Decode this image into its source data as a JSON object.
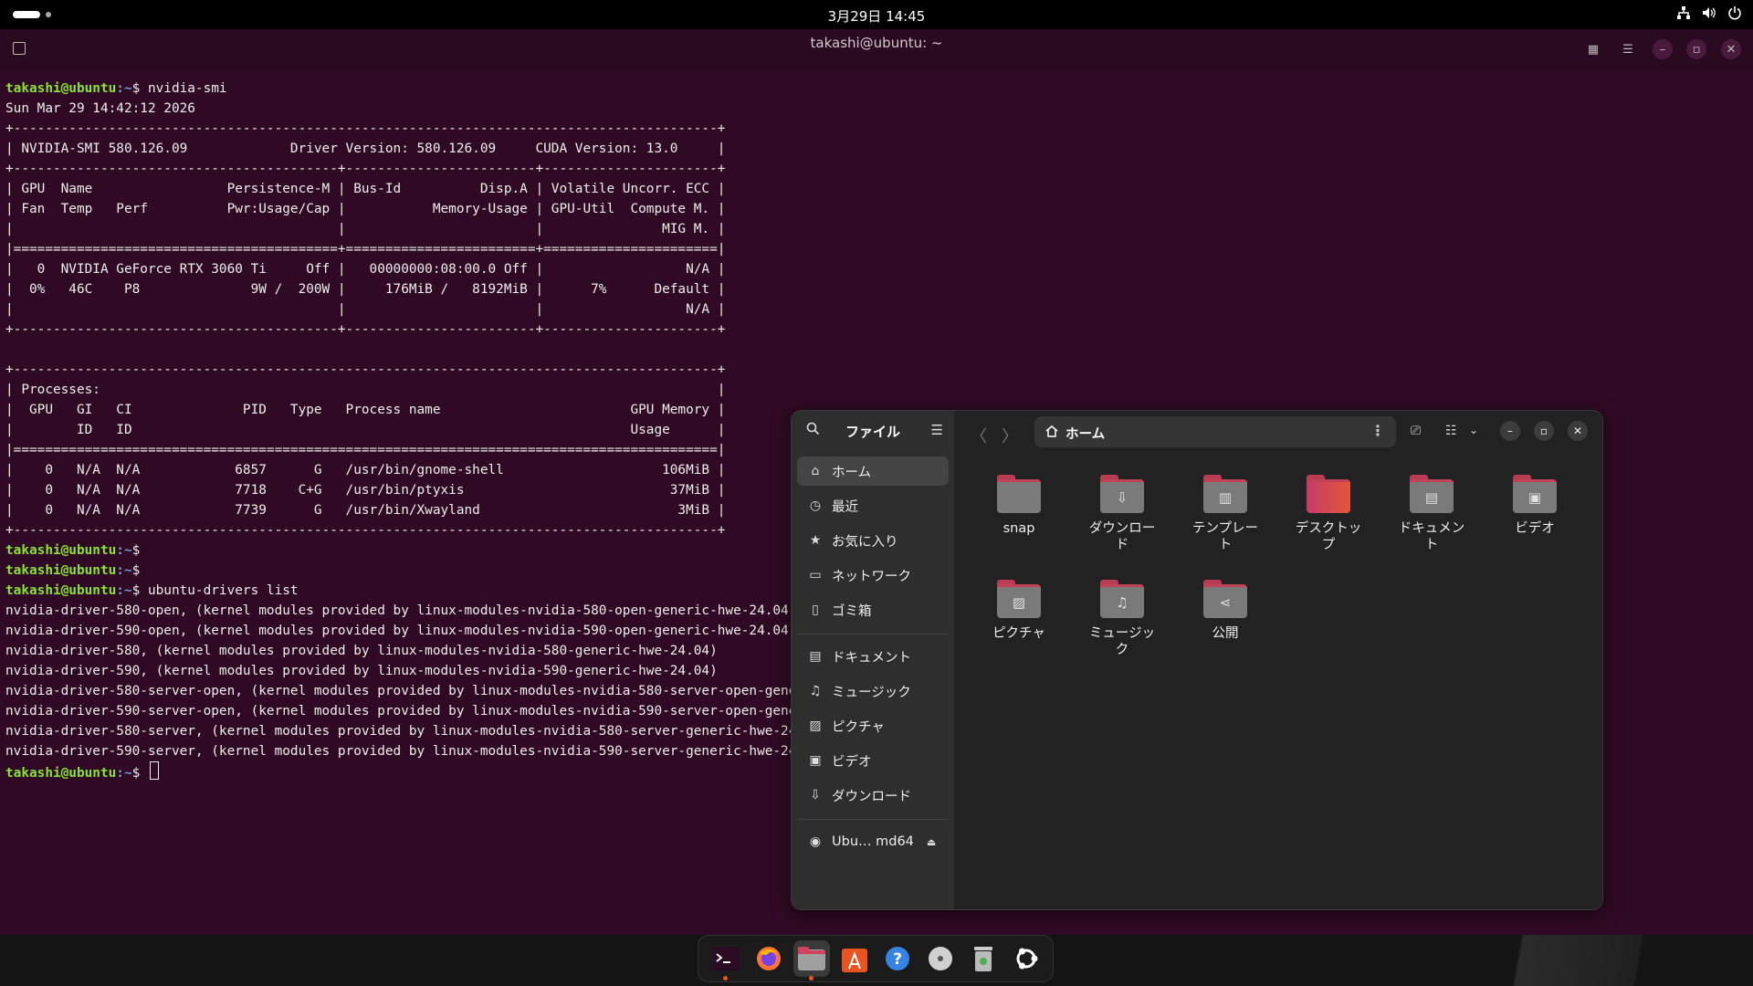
{
  "topbar": {
    "clock": "3月29日 14:45"
  },
  "terminal": {
    "title": "takashi@ubuntu: ~",
    "prompt_user": "takashi@ubuntu",
    "prompt_path": ":~",
    "prompt_sym": "$ ",
    "cmd1": "nvidia-smi",
    "output1": "Sun Mar 29 14:42:12 2026\n+-----------------------------------------------------------------------------------------+\n| NVIDIA-SMI 580.126.09             Driver Version: 580.126.09     CUDA Version: 13.0     |\n+-----------------------------------------+------------------------+----------------------+\n| GPU  Name                 Persistence-M | Bus-Id          Disp.A | Volatile Uncorr. ECC |\n| Fan  Temp   Perf          Pwr:Usage/Cap |           Memory-Usage | GPU-Util  Compute M. |\n|                                         |                        |               MIG M. |\n|=========================================+========================+======================|\n|   0  NVIDIA GeForce RTX 3060 Ti     Off |   00000000:08:00.0 Off |                  N/A |\n|  0%   46C    P8              9W /  200W |     176MiB /   8192MiB |      7%      Default |\n|                                         |                        |                  N/A |\n+-----------------------------------------+------------------------+----------------------+\n\n+-----------------------------------------------------------------------------------------+\n| Processes:                                                                              |\n|  GPU   GI   CI              PID   Type   Process name                        GPU Memory |\n|        ID   ID                                                               Usage      |\n|=========================================================================================|\n|    0   N/A  N/A            6857      G   /usr/bin/gnome-shell                    106MiB |\n|    0   N/A  N/A            7718    C+G   /usr/bin/ptyxis                          37MiB |\n|    0   N/A  N/A            7739      G   /usr/bin/Xwayland                         3MiB |\n+-----------------------------------------------------------------------------------------+",
    "cmd2": "ubuntu-drivers list",
    "output2": "nvidia-driver-580-open, (kernel modules provided by linux-modules-nvidia-580-open-generic-hwe-24.04)\nnvidia-driver-590-open, (kernel modules provided by linux-modules-nvidia-590-open-generic-hwe-24.04)\nnvidia-driver-580, (kernel modules provided by linux-modules-nvidia-580-generic-hwe-24.04)\nnvidia-driver-590, (kernel modules provided by linux-modules-nvidia-590-generic-hwe-24.04)\nnvidia-driver-580-server-open, (kernel modules provided by linux-modules-nvidia-580-server-open-generic-hwe\nnvidia-driver-590-server-open, (kernel modules provided by linux-modules-nvidia-590-server-open-generic-hwe\nnvidia-driver-580-server, (kernel modules provided by linux-modules-nvidia-580-server-generic-hwe-24.04)\nnvidia-driver-590-server, (kernel modules provided by linux-modules-nvidia-590-server-generic-hwe-24.04)"
  },
  "files": {
    "sidebar_title": "ファイル",
    "location": "ホーム",
    "places": [
      {
        "label": "ホーム",
        "icon": "home-icon"
      },
      {
        "label": "最近",
        "icon": "clock-icon"
      },
      {
        "label": "お気に入り",
        "icon": "star-icon"
      },
      {
        "label": "ネットワーク",
        "icon": "network-icon"
      },
      {
        "label": "ゴミ箱",
        "icon": "trash-icon"
      }
    ],
    "bookmarks": [
      {
        "label": "ドキュメント",
        "icon": "document-icon"
      },
      {
        "label": "ミュージック",
        "icon": "music-icon"
      },
      {
        "label": "ピクチャ",
        "icon": "picture-icon"
      },
      {
        "label": "ビデオ",
        "icon": "video-icon"
      },
      {
        "label": "ダウンロード",
        "icon": "download-icon"
      }
    ],
    "drive": {
      "label": "Ubu… md64",
      "icon": "disc-icon"
    },
    "folders": [
      {
        "name": "snap",
        "glyph": ""
      },
      {
        "name": "ダウンロー\nド",
        "glyph": "⇩"
      },
      {
        "name": "テンプレー\nト",
        "glyph": "▥"
      },
      {
        "name": "デスクトッ\nプ",
        "glyph": ""
      },
      {
        "name": "ドキュメン\nト",
        "glyph": "▤"
      },
      {
        "name": "ビデオ",
        "glyph": "▣"
      },
      {
        "name": "ピクチャ",
        "glyph": "▨"
      },
      {
        "name": "ミュージッ\nク",
        "glyph": "♫"
      },
      {
        "name": "公開",
        "glyph": "⋖"
      }
    ]
  },
  "dock": {
    "apps": [
      "terminal-icon",
      "firefox-icon",
      "files-icon",
      "app-center-icon",
      "help-icon",
      "disc-icon",
      "trash-icon",
      "ubuntu-icon"
    ]
  },
  "colors": {
    "prompt_green": "#8ae234",
    "prompt_blue": "#729fcf",
    "ubuntu_orange": "#e95420",
    "terminal_bg": "#300a24"
  }
}
